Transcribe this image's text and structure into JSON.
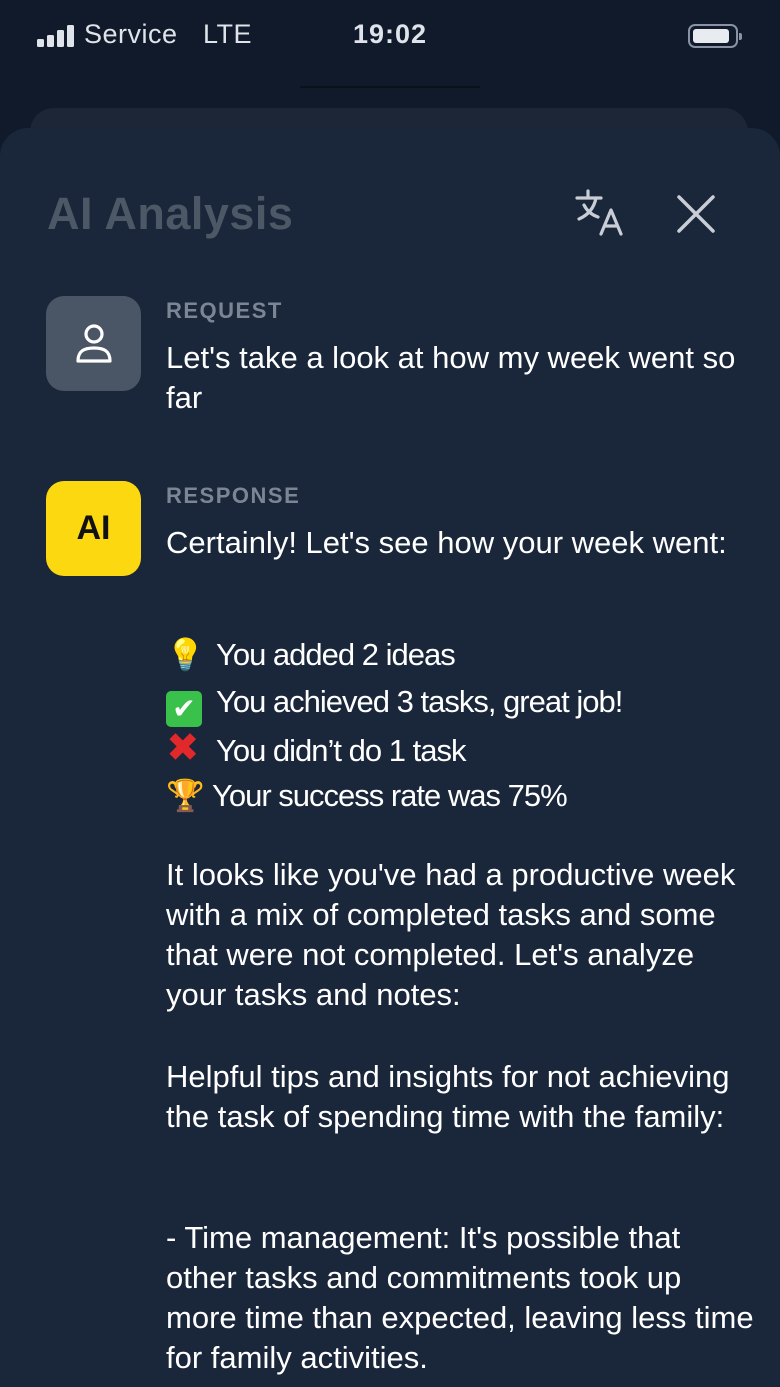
{
  "status_bar": {
    "carrier": "Service",
    "network": "LTE",
    "time": "19:02"
  },
  "header": {
    "title": "AI Analysis",
    "translate_icon": "translate-icon",
    "close_icon": "close-icon"
  },
  "request": {
    "label": "REQUEST",
    "avatar_icon": "user-icon",
    "text": "Let's take a look at how my week went so far"
  },
  "response": {
    "label": "RESPONSE",
    "avatar_text": "AI",
    "intro": "Certainly! Let's see how your week went:",
    "stats": [
      {
        "icon": "💡",
        "text": "You added 2 ideas"
      },
      {
        "icon": "✔",
        "text": "You achieved 3 tasks, great job!"
      },
      {
        "icon": "✖",
        "text": "You didn’t do 1 task"
      },
      {
        "icon": "🏆",
        "text": "Your success rate was 75%"
      }
    ],
    "paragraph1": "It looks like you've had a productive week with a mix of completed tasks and some that were not completed. Let's analyze your tasks and notes:",
    "paragraph2": "Helpful tips and insights for not achieving the task of spending time with the family:",
    "paragraph3": "- Time management: It's possible that other tasks and commitments took up more time than expected, leaving less time for family activities."
  },
  "colors": {
    "background": "#101a2a",
    "sheet": "#1a2639",
    "ai_avatar": "#fcd811",
    "user_avatar": "#4a5565"
  }
}
